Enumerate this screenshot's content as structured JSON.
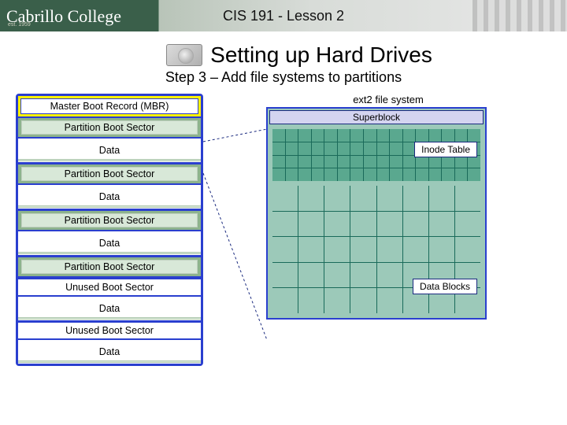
{
  "banner": {
    "logo": "Cabrillo College",
    "established": "est. 1959",
    "course": "CIS 191 - Lesson 2"
  },
  "heading": {
    "title": "Setting up Hard Drives",
    "subtitle": "Step 3 – Add file systems to partitions"
  },
  "disk": {
    "mbr": "Master Boot Record (MBR)",
    "rows": [
      {
        "type": "pbs",
        "label": "Partition Boot Sector"
      },
      {
        "type": "data",
        "label": "Data"
      },
      {
        "type": "pbs",
        "label": "Partition Boot Sector"
      },
      {
        "type": "data",
        "label": "Data"
      },
      {
        "type": "pbs",
        "label": "Partition Boot Sector"
      },
      {
        "type": "data",
        "label": "Data"
      },
      {
        "type": "pbs",
        "label": "Partition Boot Sector"
      },
      {
        "type": "ubs",
        "label": "Unused Boot Sector"
      },
      {
        "type": "data",
        "label": "Data"
      },
      {
        "type": "ubs",
        "label": "Unused Boot Sector"
      },
      {
        "type": "data",
        "label": "Data"
      }
    ]
  },
  "filesystem": {
    "name": "ext2 file system",
    "superblock": "Superblock",
    "inode_table": "Inode Table",
    "data_blocks": "Data Blocks"
  }
}
